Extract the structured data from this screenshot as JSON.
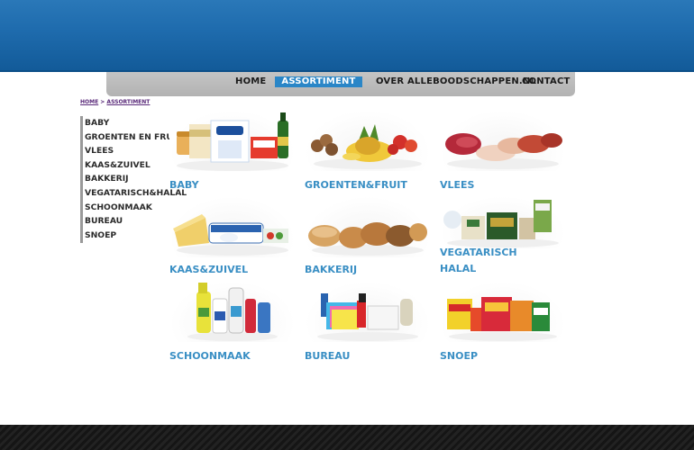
{
  "nav": {
    "home": "HOME",
    "assortiment": "ASSORTIMENT",
    "over": "OVER ALLEBOODSCHAPPEN.NL",
    "contact": "CONTACT"
  },
  "breadcrumb": {
    "home": "HOME",
    "separator": " > ",
    "current": "ASSORTIMENT"
  },
  "sidebar": {
    "items": [
      {
        "label": "BABY"
      },
      {
        "label": "GROENTEN EN FRUIT"
      },
      {
        "label": "VLEES"
      },
      {
        "label": "KAAS&ZUIVEL"
      },
      {
        "label": "BAKKERIJ"
      },
      {
        "label": "VEGATARISCH&HALAL"
      },
      {
        "label": "SCHOONMAAK"
      },
      {
        "label": "BUREAU"
      },
      {
        "label": "SNOEP"
      }
    ]
  },
  "categories": [
    {
      "label": "BABY"
    },
    {
      "label": "GROENTEN&FRUIT"
    },
    {
      "label": "VLEES"
    },
    {
      "label": "KAAS&ZUIVEL"
    },
    {
      "label": "BAKKERIJ"
    },
    {
      "label_line1": "VEGATARISCH",
      "label_line2": "HALAL"
    },
    {
      "label": "SCHOONMAAK"
    },
    {
      "label": "BUREAU"
    },
    {
      "label": "SNOEP"
    }
  ],
  "colors": {
    "header_blue": "#1f6cae",
    "nav_active": "#2a86c7",
    "category_label": "#3a8fc4",
    "breadcrumb": "#5a2a7a"
  }
}
